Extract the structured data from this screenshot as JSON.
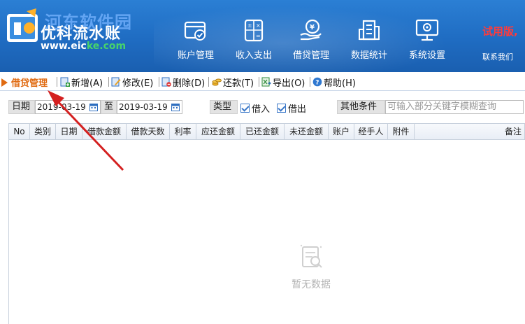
{
  "header": {
    "watermark": "河东软件园",
    "app_title": "优科流水账",
    "url_prefix": "www.eic",
    "url_suffix": "ke.com",
    "trial_text": "试用版,",
    "contact": "联系我们",
    "nav": [
      {
        "label": "账户管理",
        "icon": "account-card-icon"
      },
      {
        "label": "收入支出",
        "icon": "calculator-icon"
      },
      {
        "label": "借贷管理",
        "icon": "hand-coin-icon"
      },
      {
        "label": "数据统计",
        "icon": "building-stats-icon"
      },
      {
        "label": "系统设置",
        "icon": "monitor-gear-icon"
      }
    ]
  },
  "breadcrumb": "借贷管理",
  "toolbar": {
    "add": "新增(A)",
    "edit": "修改(E)",
    "delete": "删除(D)",
    "repay": "还款(T)",
    "export": "导出(O)",
    "help": "帮助(H)"
  },
  "filter": {
    "date_label": "日期",
    "date_from": "2019-03-19",
    "to_label": "至",
    "date_to": "2019-03-19",
    "type_label": "类型",
    "borrow_in": "借入",
    "borrow_out": "借出",
    "other_label": "其他条件",
    "search_placeholder": "可输入部分关键字模糊查询"
  },
  "table": {
    "columns": [
      "No",
      "类别",
      "日期",
      "借款金额",
      "借款天数",
      "利率",
      "应还金额",
      "已还金额",
      "未还金额",
      "账户",
      "经手人",
      "附件",
      "备注"
    ]
  },
  "empty_text": "暂无数据",
  "colors": {
    "header_blue": "#2b7fd4",
    "accent_orange": "#e06a10",
    "trial_red": "#ff3b3b",
    "arrow_red": "#d42020"
  }
}
